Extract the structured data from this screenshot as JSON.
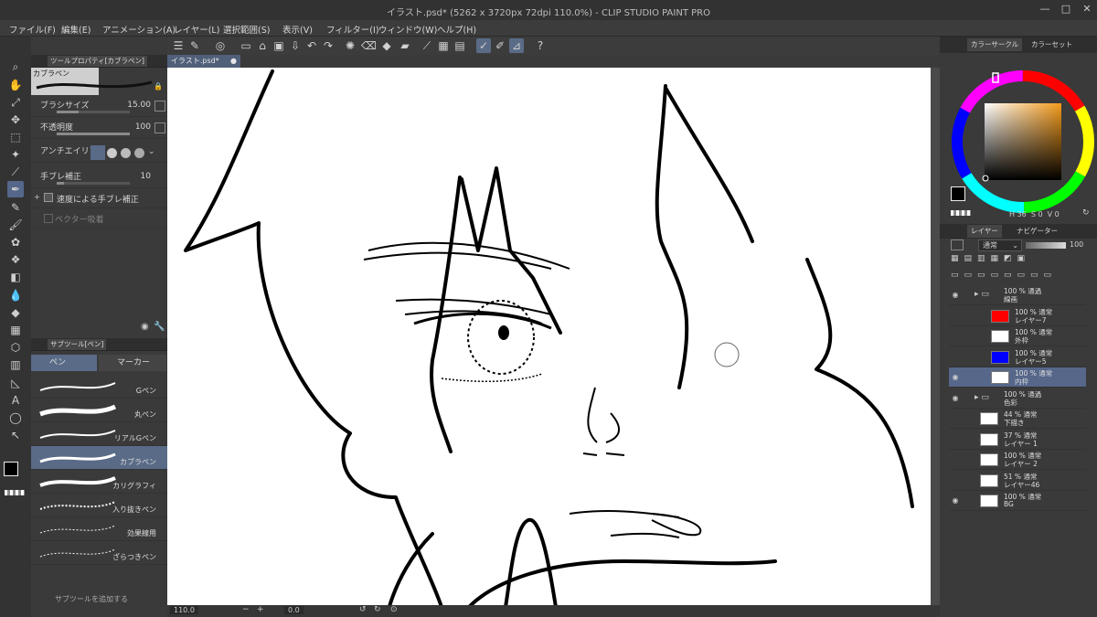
{
  "window": {
    "title": "イラスト.psd* (5262 x 3720px 72dpi 110.0%) - CLIP STUDIO PAINT PRO",
    "minimize": "—",
    "maximize": "□",
    "close": "✕"
  },
  "menu": [
    "ファイル(F)",
    "編集(E)",
    "アニメーション(A)",
    "レイヤー(L)",
    "選択範囲(S)",
    "表示(V)",
    "フィルター(I)",
    "ウィンドウ(W)",
    "ヘルプ(H)"
  ],
  "tool_property": {
    "tab": "ツールプロパティ[カブラペン]",
    "preset": "カブラペン",
    "brush_size": {
      "label": "ブラシサイズ",
      "value": "15.00",
      "fill": 0.3
    },
    "opacity": {
      "label": "不透明度",
      "value": "100",
      "fill": 1.0
    },
    "antialias": {
      "label": "アンチエイリアス"
    },
    "stabilization": {
      "label": "手ブレ補正",
      "value": "10"
    },
    "speed_stab": {
      "label": "速度による手ブレ補正"
    },
    "vector_snap": {
      "label": "ベクター吸着"
    }
  },
  "sub_tool": {
    "tab": "サブツール[ペン]",
    "groups": [
      "ペン",
      "マーカー"
    ],
    "brushes": [
      {
        "name": "Gペン",
        "selected": false
      },
      {
        "name": "丸ペン",
        "selected": false
      },
      {
        "name": "リアルGペン",
        "selected": false
      },
      {
        "name": "カブラペン",
        "selected": true
      },
      {
        "name": "カリグラフィ",
        "selected": false
      },
      {
        "name": "入り抜きペン",
        "selected": false
      },
      {
        "name": "効果線用",
        "selected": false
      },
      {
        "name": "ざらつきペン",
        "selected": false
      }
    ],
    "add_subtool": "サブツールを追加する"
  },
  "document": {
    "tab": "イラスト.psd*"
  },
  "status": {
    "zoom": "110.0",
    "angle": "0.0"
  },
  "color": {
    "tabs": [
      "カラーサークル",
      "カラーセット"
    ],
    "hsv": {
      "h": "36",
      "s": "0",
      "v": "0"
    },
    "main": "#000000"
  },
  "layer_panel": {
    "tabs": [
      "レイヤー",
      "ナビゲーター"
    ],
    "blend": "通常",
    "opacity": "100",
    "layers": [
      {
        "line1": "100 % 通過",
        "line2": "線画",
        "type": "folder",
        "visible": true,
        "selected": false,
        "indent": 0,
        "swatch": ""
      },
      {
        "line1": "100 % 通常",
        "line2": "レイヤー7",
        "type": "layer",
        "visible": false,
        "selected": false,
        "indent": 1,
        "swatch": "#ff0000"
      },
      {
        "line1": "100 % 通常",
        "line2": "外枠",
        "type": "layer",
        "visible": false,
        "selected": false,
        "indent": 1,
        "swatch": ""
      },
      {
        "line1": "100 % 通常",
        "line2": "レイヤー5",
        "type": "layer",
        "visible": false,
        "selected": false,
        "indent": 1,
        "swatch": "#0000ff"
      },
      {
        "line1": "100 % 通常",
        "line2": "内枠",
        "type": "layer",
        "visible": true,
        "selected": true,
        "indent": 1,
        "swatch": ""
      },
      {
        "line1": "100 % 通過",
        "line2": "色彩",
        "type": "folder",
        "visible": true,
        "selected": false,
        "indent": 0,
        "swatch": ""
      },
      {
        "line1": "44 % 通常",
        "line2": "下描き",
        "type": "layer",
        "visible": false,
        "selected": false,
        "indent": 0,
        "swatch": ""
      },
      {
        "line1": "37 % 通常",
        "line2": "レイヤー 1",
        "type": "layer",
        "visible": false,
        "selected": false,
        "indent": 0,
        "swatch": ""
      },
      {
        "line1": "100 % 通常",
        "line2": "レイヤー 2",
        "type": "layer",
        "visible": false,
        "selected": false,
        "indent": 0,
        "swatch": ""
      },
      {
        "line1": "51 % 通常",
        "line2": "レイヤー46",
        "type": "layer",
        "visible": false,
        "selected": false,
        "indent": 0,
        "swatch": ""
      },
      {
        "line1": "100 % 通常",
        "line2": "BG",
        "type": "layer",
        "visible": true,
        "selected": false,
        "indent": 0,
        "swatch": ""
      }
    ]
  }
}
